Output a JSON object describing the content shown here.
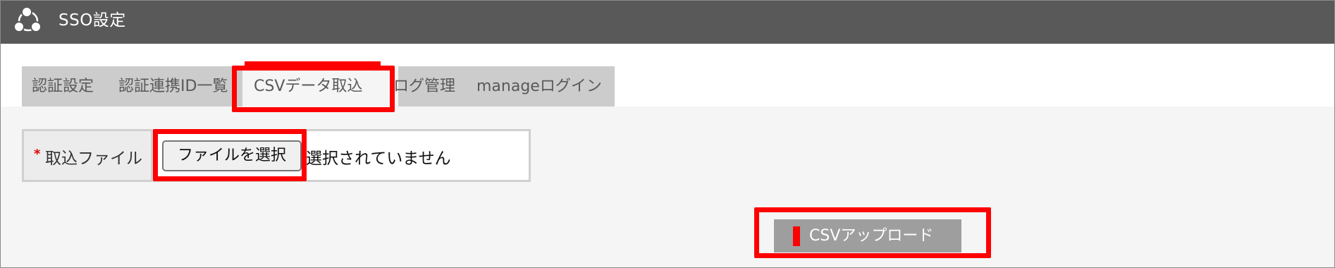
{
  "app": {
    "title": "SSO設定",
    "logo_icon": "share-network-icon"
  },
  "tabs": [
    {
      "label": "認証設定",
      "active": false
    },
    {
      "label": "認証連携ID一覧",
      "active": false
    },
    {
      "label": "CSVデータ取込",
      "active": true
    },
    {
      "label": "ログ管理",
      "active": false
    },
    {
      "label": "manageログイン",
      "active": false
    }
  ],
  "form": {
    "required_mark": "*",
    "file_label": "取込ファイル",
    "choose_button": "ファイルを選択",
    "no_file_text": "選択されていません"
  },
  "actions": {
    "upload_label": "CSVアップロード"
  },
  "colors": {
    "header_bg": "#595959",
    "tabbar_bg": "#cccccc",
    "content_bg": "#f5f5f5",
    "highlight": "#ff0000",
    "upload_bg": "#9e9e9e"
  }
}
